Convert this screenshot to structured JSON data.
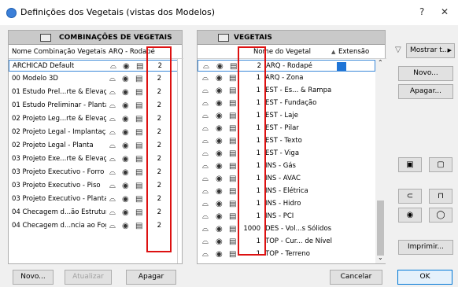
{
  "window": {
    "title": "Definições dos Vegetais (vistas dos Modelos)",
    "help": "?",
    "close": "✕"
  },
  "left": {
    "header": "COMBINAÇÕES DE VEGETAIS",
    "col_name": "Nome Combinação Vegetais",
    "col_veg": "ARQ - Rodapé",
    "rows": [
      {
        "name": "ARCHICAD Default",
        "val": "2"
      },
      {
        "name": "00 Modelo 3D",
        "val": "2"
      },
      {
        "name": "01 Estudo Prel...rte & Elevação",
        "val": "2"
      },
      {
        "name": "01 Estudo Preliminar - Planta",
        "val": "2"
      },
      {
        "name": "02 Projeto Leg...rte & Elevação",
        "val": "2"
      },
      {
        "name": "02 Projeto Legal - Implantação",
        "val": "2"
      },
      {
        "name": "02 Projeto Legal - Planta",
        "val": "2"
      },
      {
        "name": "03 Projeto Exe...rte & Elevação",
        "val": "2"
      },
      {
        "name": "03 Projeto Executivo - Forro",
        "val": "2"
      },
      {
        "name": "03 Projeto Executivo - Piso",
        "val": "2"
      },
      {
        "name": "03 Projeto Executivo - Planta",
        "val": "2"
      },
      {
        "name": "04 Checagem d...ão Estrutural",
        "val": "2"
      },
      {
        "name": "04 Checagem d...ncia ao Fogo",
        "val": "2"
      }
    ],
    "btn_new": "Novo...",
    "btn_update": "Atualizar",
    "btn_delete": "Apagar"
  },
  "right": {
    "header": "VEGETAIS",
    "col_name": "Nome do Vegetal",
    "col_ext": "Extensão",
    "sort_icon": "▲",
    "rows": [
      {
        "val": "2",
        "name": "ARQ - Rodapé"
      },
      {
        "val": "1",
        "name": "ARQ - Zona"
      },
      {
        "val": "1",
        "name": "EST - Es... & Rampa"
      },
      {
        "val": "1",
        "name": "EST - Fundação"
      },
      {
        "val": "1",
        "name": "EST - Laje"
      },
      {
        "val": "1",
        "name": "EST - Pilar"
      },
      {
        "val": "1",
        "name": "EST - Texto"
      },
      {
        "val": "1",
        "name": "EST - Viga"
      },
      {
        "val": "1",
        "name": "INS - Gás"
      },
      {
        "val": "1",
        "name": "INS - AVAC"
      },
      {
        "val": "1",
        "name": "INS - Elétrica"
      },
      {
        "val": "1",
        "name": "INS - Hidro"
      },
      {
        "val": "1",
        "name": "INS - PCI"
      },
      {
        "val": "1000",
        "name": "DES - Vol...s Sólidos"
      },
      {
        "val": "1",
        "name": "TOP - Cur... de Nível"
      },
      {
        "val": "1",
        "name": "TOP - Terreno"
      }
    ],
    "btn_cancel": "Cancelar"
  },
  "side": {
    "filter_label": "Mostrar t...",
    "btn_new": "Novo...",
    "btn_delete": "Apagar...",
    "btn_print": "Imprimir...",
    "btn_ok": "OK"
  },
  "icons": {
    "lock": "lock-icon",
    "eye": "eye-icon",
    "layer": "layer-icon",
    "filter": "filter-icon"
  }
}
